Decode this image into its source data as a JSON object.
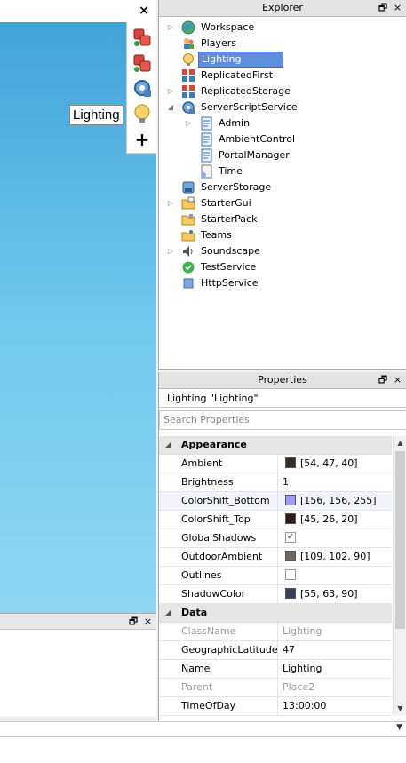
{
  "viewport": {
    "close_glyph": "×",
    "tooltip": "Lighting",
    "toolbar": [
      {
        "icon": "red-blocks-icon"
      },
      {
        "icon": "red-blocks-icon"
      },
      {
        "icon": "blue-gear-icon"
      },
      {
        "icon": "lightbulb-icon"
      },
      {
        "icon": "plus-icon",
        "glyph": "+"
      }
    ]
  },
  "explorer": {
    "title": "Explorer",
    "float_glyph": "🗗",
    "close_glyph": "×",
    "items": [
      {
        "label": "Workspace",
        "icon": "globe-icon",
        "indent": 0,
        "arrow": "▷"
      },
      {
        "label": "Players",
        "icon": "players-icon",
        "indent": 0,
        "arrow": ""
      },
      {
        "label": "Lighting",
        "icon": "lightbulb-icon",
        "indent": 0,
        "arrow": "",
        "selected": true
      },
      {
        "label": "ReplicatedFirst",
        "icon": "replicated-icon",
        "indent": 0,
        "arrow": ""
      },
      {
        "label": "ReplicatedStorage",
        "icon": "replicated-icon",
        "indent": 0,
        "arrow": "▷"
      },
      {
        "label": "ServerScriptService",
        "icon": "server-script-service-icon",
        "indent": 0,
        "arrow": "◢"
      },
      {
        "label": "Admin",
        "icon": "script-icon",
        "indent": 1,
        "arrow": "▷"
      },
      {
        "label": "AmbientControl",
        "icon": "script-icon",
        "indent": 1,
        "arrow": ""
      },
      {
        "label": "PortalManager",
        "icon": "script-icon",
        "indent": 1,
        "arrow": ""
      },
      {
        "label": "Time",
        "icon": "module-script-icon",
        "indent": 1,
        "arrow": ""
      },
      {
        "label": "ServerStorage",
        "icon": "server-storage-icon",
        "indent": 0,
        "arrow": ""
      },
      {
        "label": "StarterGui",
        "icon": "folder-icon",
        "indent": 0,
        "arrow": "▷"
      },
      {
        "label": "StarterPack",
        "icon": "backpack-icon",
        "indent": 0,
        "arrow": ""
      },
      {
        "label": "Teams",
        "icon": "teams-folder-icon",
        "indent": 0,
        "arrow": ""
      },
      {
        "label": "Soundscape",
        "icon": "speaker-icon",
        "indent": 0,
        "arrow": "▷"
      },
      {
        "label": "TestService",
        "icon": "check-icon",
        "indent": 0,
        "arrow": ""
      },
      {
        "label": "HttpService",
        "icon": "http-icon",
        "indent": 0,
        "arrow": ""
      }
    ]
  },
  "properties": {
    "title": "Properties",
    "float_glyph": "🗗",
    "close_glyph": "×",
    "caption": "Lighting \"Lighting\"",
    "search_placeholder": "Search Properties",
    "categories": [
      {
        "name": "Appearance",
        "rows": [
          {
            "name": "Ambient",
            "value": "[54, 47, 40]",
            "swatch": "#362f28"
          },
          {
            "name": "Brightness",
            "value": "1"
          },
          {
            "name": "ColorShift_Bottom",
            "value": "[156, 156, 255]",
            "swatch": "#9c9cff",
            "hl": true
          },
          {
            "name": "ColorShift_Top",
            "value": "[45, 26, 20]",
            "swatch": "#2d1a14"
          },
          {
            "name": "GlobalShadows",
            "checkbox": true,
            "checked": true
          },
          {
            "name": "OutdoorAmbient",
            "value": "[109, 102, 90]",
            "swatch": "#6d665a"
          },
          {
            "name": "Outlines",
            "checkbox": true,
            "checked": false
          },
          {
            "name": "ShadowColor",
            "value": "[55, 63, 90]",
            "swatch": "#373f5a"
          }
        ]
      },
      {
        "name": "Data",
        "rows": [
          {
            "name": "ClassName",
            "value": "Lighting",
            "readonly": true
          },
          {
            "name": "GeographicLatitude",
            "value": "47"
          },
          {
            "name": "Name",
            "value": "Lighting"
          },
          {
            "name": "Parent",
            "value": "Place2",
            "readonly": true
          },
          {
            "name": "TimeOfDay",
            "value": "13:00:00"
          }
        ]
      }
    ]
  },
  "output_panel": {
    "float_glyph": "🗗",
    "close_glyph": "×"
  },
  "command_bar": {
    "dropdown_glyph": "▼"
  }
}
